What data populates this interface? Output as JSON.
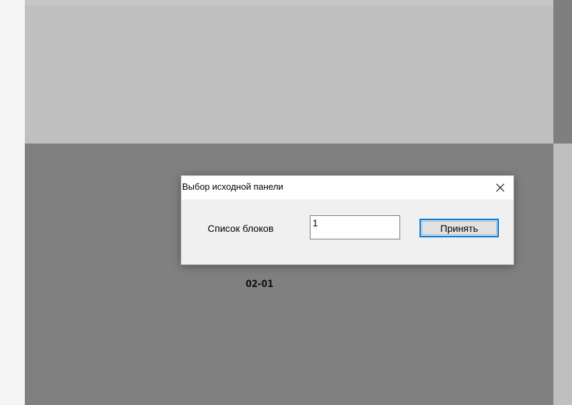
{
  "dialog": {
    "title": "Выбор исходной панели",
    "close_icon": "close-icon",
    "field_label": "Список блоков",
    "field_value": "1",
    "accept_label": "Принять"
  },
  "canvas": {
    "panel_label": "02-01"
  },
  "colors": {
    "accent": "#0078d7",
    "dialog_bg": "#f0f0f0",
    "panel_light": "#c0c0c0",
    "panel_dark": "#808080"
  }
}
